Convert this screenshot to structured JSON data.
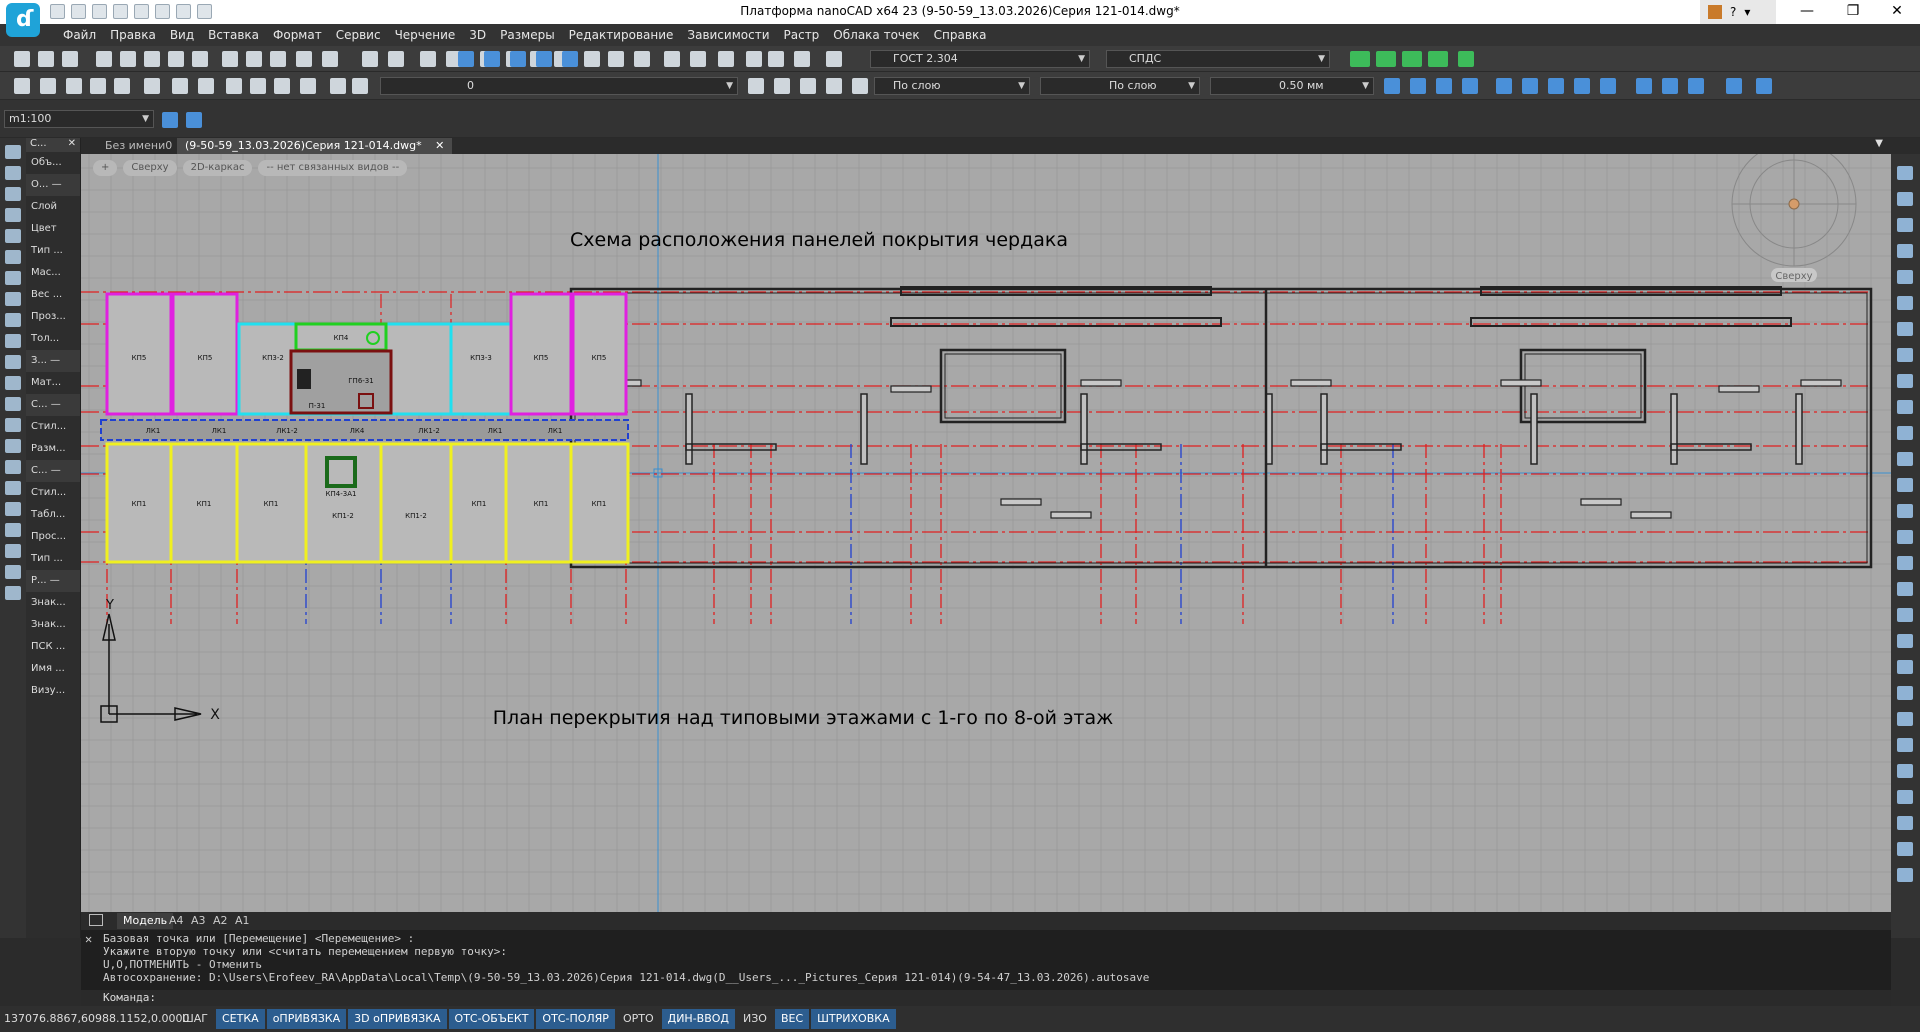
{
  "titlebar": {
    "title": "Платформа nanoCAD x64 23 (9-50-59_13.03.2026)Серия 121-014.dwg*",
    "help": "?",
    "minimize": "—",
    "maximize": "❐",
    "close": "✕"
  },
  "menu": [
    "Файл",
    "Правка",
    "Вид",
    "Вставка",
    "Формат",
    "Сервис",
    "Черчение",
    "3D",
    "Размеры",
    "Редактирование",
    "Зависимости",
    "Растр",
    "Облака точек",
    "Справка"
  ],
  "toolbar": {
    "text_style": "ГОСТ 2.304",
    "dim_style": "СПДС",
    "layer": "0",
    "color": "По слою",
    "linetype": "По слою",
    "lineweight": "0.50 мм",
    "scale": "m1:100"
  },
  "properties_panel": {
    "title": "С...",
    "rows": [
      "Объ...",
      "О... —",
      "Слой",
      "Цвет",
      "Тип ...",
      "Мас...",
      "Вес ...",
      "Проз...",
      "Тол...",
      "З... —",
      "Мат...",
      "С... —",
      "Стил...",
      "Разм...",
      "С... —",
      "Стил...",
      "Табл...",
      "Прос...",
      "Тип ...",
      "Р... —",
      "Знак...",
      "Знак...",
      "ПСК ...",
      "Имя ...",
      "Визу..."
    ]
  },
  "doc_tabs": [
    {
      "label": "Без имени0",
      "active": false
    },
    {
      "label": "(9-50-59_13.03.2026)Серия 121-014.dwg*",
      "active": true
    }
  ],
  "view_pills": [
    "+",
    "Сверху",
    "2D-каркас",
    "-- нет связанных видов --"
  ],
  "viewcube_label": "Сверху",
  "drawing": {
    "title_top": "Схема расположения панелей покрытия чердака",
    "title_bottom": "План перекрытия над типовыми этажами с 1-го по 8-ой этаж",
    "panel_labels_top": [
      "КП5",
      "КП5",
      "КП3-2",
      "КП3-3",
      "КП5",
      "КП5"
    ],
    "panel_labels_bottom": [
      "КП1",
      "КП1",
      "КП1",
      "КП1-2",
      "КП1",
      "КП1",
      "КП1"
    ],
    "beam_labels": [
      "ЛК1",
      "ЛК1",
      "ЛК1-2",
      "ЛК4",
      "ЛК1-2",
      "ЛК1",
      "ЛК1"
    ],
    "shaft_labels": [
      "КП4",
      "ГП6-31",
      "П-31",
      "КП4-3А1"
    ],
    "axis_y": "Y",
    "axis_x": "X"
  },
  "layout_tabs": [
    {
      "label": "Модель",
      "active": true
    },
    {
      "label": "A4",
      "active": false
    },
    {
      "label": "A3",
      "active": false
    },
    {
      "label": "A2",
      "active": false
    },
    {
      "label": "A1",
      "active": false
    }
  ],
  "command_line": {
    "history": [
      "Базовая точка или [Перемещение] <Перемещение> :",
      "Укажите вторую точку или <считать перемещением первую точку>:",
      "U,O,ПОТМЕНИТЬ - Отменить",
      "Автосохранение: D:\\Users\\Erofeev_RA\\AppData\\Local\\Temp\\(9-50-59_13.03.2026)Серия 121-014.dwg(D__Users_..._Pictures_Серия 121-014)(9-54-47_13.03.2026).autosave"
    ],
    "prompt": "Команда:"
  },
  "statusbar": {
    "coords": "137076.8867,60988.1152,0.0000",
    "buttons": [
      {
        "label": "ШАГ",
        "on": false
      },
      {
        "label": "СЕТКА",
        "on": true
      },
      {
        "label": "оПРИВЯЗКА",
        "on": true
      },
      {
        "label": "3D оПРИВЯЗКА",
        "on": true
      },
      {
        "label": "ОТС-ОБЪЕКТ",
        "on": true
      },
      {
        "label": "ОТС-ПОЛЯР",
        "on": true
      },
      {
        "label": "ОРТО",
        "on": false
      },
      {
        "label": "ДИН-ВВОД",
        "on": true
      },
      {
        "label": "ИЗО",
        "on": false
      },
      {
        "label": "ВЕС",
        "on": true
      },
      {
        "label": "ШТРИХОВКА",
        "on": true
      }
    ]
  },
  "colors": {
    "canvas": "#a8a8a8",
    "grid": "#9b9b9b",
    "axis_red": "#e02020",
    "axis_blue": "#2040d0",
    "magenta": "#e020e0",
    "cyan": "#20e0f0",
    "yellow": "#f0f020",
    "green": "#20d020",
    "maroon": "#7a1010",
    "status_on": "#2c5d8f"
  }
}
